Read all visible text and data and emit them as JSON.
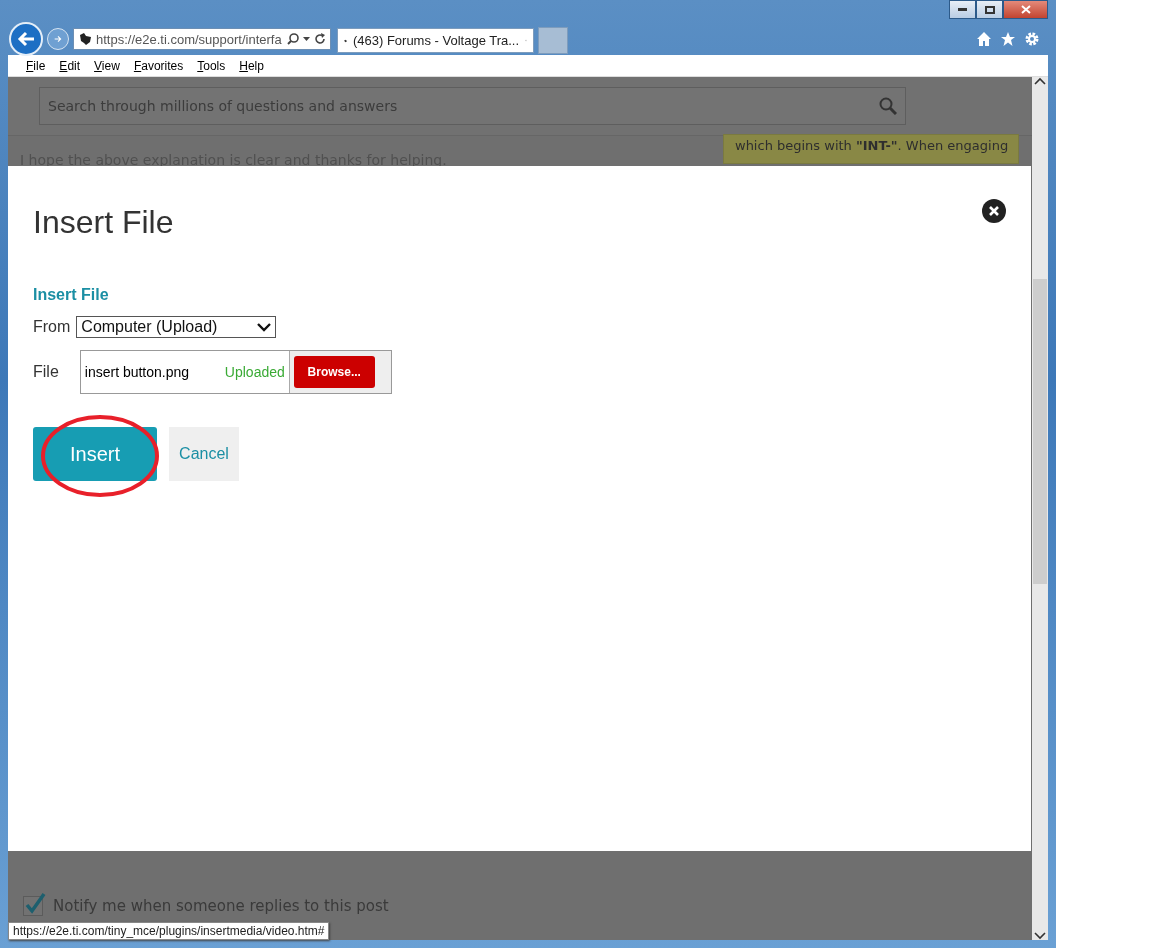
{
  "browser": {
    "address": "https://e2e.ti.com/support/interfa",
    "tabs": [
      {
        "label": "(463) Forums - Voltage Tra...",
        "selected": true
      }
    ],
    "menu": [
      "File",
      "Edit",
      "View",
      "Favorites",
      "Tools",
      "Help"
    ]
  },
  "page": {
    "search_placeholder": "Search through millions of questions and answers",
    "post_text": "I hope the above explanation is clear and thanks for helping.",
    "note_text": "which begins with **\"INT-\"**. When engaging",
    "notify": {
      "label": "Notify me when someone replies to this post",
      "checked": true
    }
  },
  "dialog": {
    "title": "Insert File",
    "section": "Insert File",
    "from_label": "From",
    "from_value": "Computer (Upload)",
    "file_label": "File",
    "file_name": "insert button.png",
    "file_status": "Uploaded",
    "browse": "Browse...",
    "buttons": [
      {
        "label": "Insert",
        "kind": "primary",
        "circled": true
      },
      {
        "label": "Cancel",
        "kind": "secondary",
        "circled": false
      }
    ]
  },
  "status_url": "https://e2e.ti.com/tiny_mce/plugins/insertmedia/video.htm#"
}
